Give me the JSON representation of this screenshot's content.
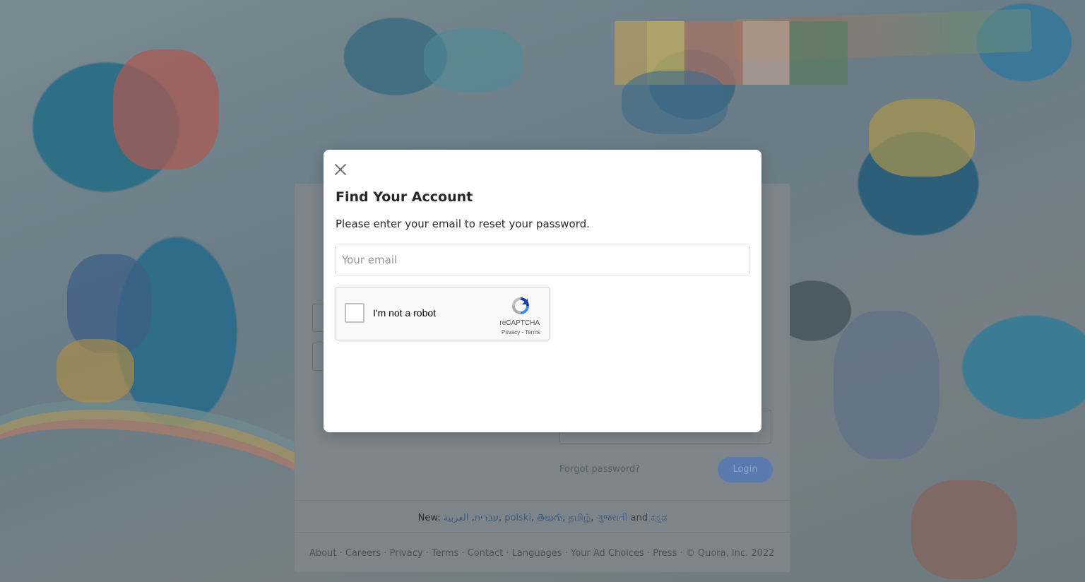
{
  "modal": {
    "title": "Find Your Account",
    "description": "Please enter your email to reset your password.",
    "email_placeholder": "Your email",
    "email_value": ""
  },
  "recaptcha": {
    "label": "I'm not a robot",
    "brand": "reCAPTCHA",
    "privacy_link": "Privacy",
    "separator": " - ",
    "terms_link": "Terms",
    "checked": false
  },
  "background_page": {
    "forgot_password": "Forgot password?",
    "login_button": "Login",
    "languages": {
      "prefix": "New:",
      "items": [
        "עברית",
        "العربية",
        "polski",
        "తెలుగు",
        "தமிழ்",
        "ગુજરાતી"
      ],
      "and_word": "and",
      "last_item": "ಕನ್ನಡ"
    },
    "footer_links": [
      "About",
      "Careers",
      "Privacy",
      "Terms",
      "Contact",
      "Languages",
      "Your Ad Choices",
      "Press",
      "© Quora, Inc. 2022"
    ]
  },
  "colors": {
    "overlay_dim": "#6f7d86",
    "modal_bg": "#ffffff",
    "title_text": "#282829",
    "login_button": "#5a7ab0"
  }
}
